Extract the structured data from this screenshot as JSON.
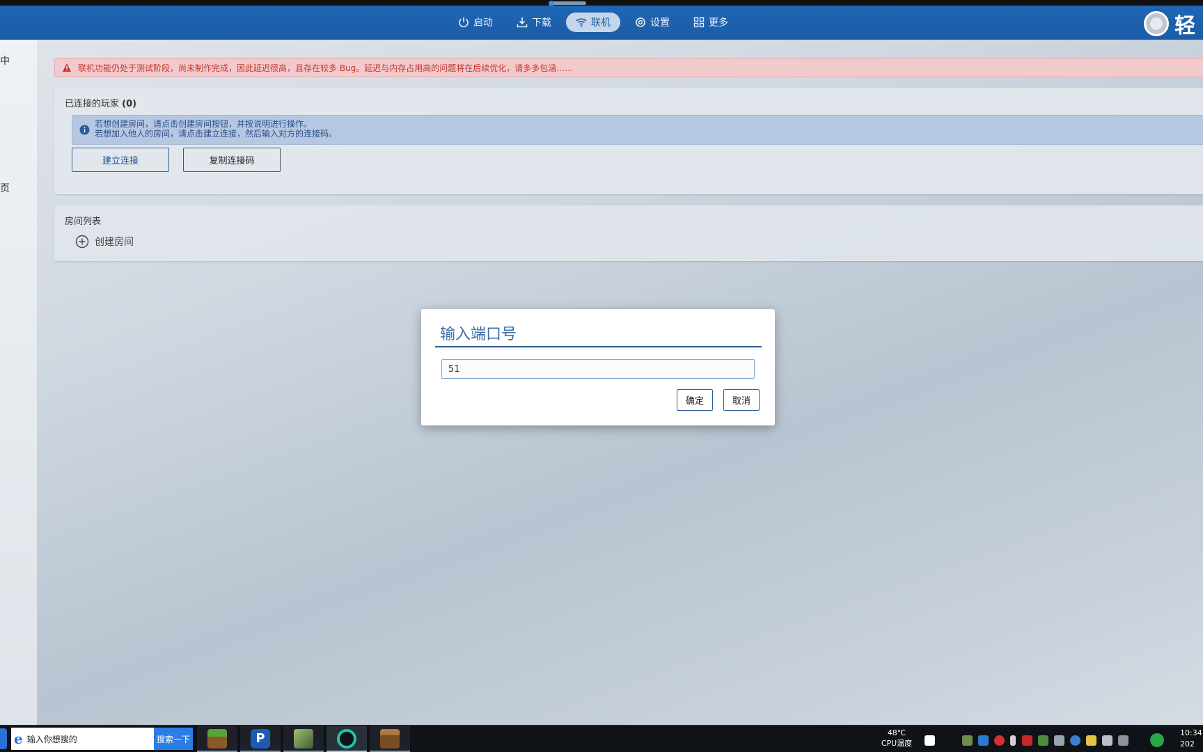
{
  "nav": {
    "items": [
      {
        "label": "启动",
        "icon": "power-icon"
      },
      {
        "label": "下载",
        "icon": "download-icon"
      },
      {
        "label": "联机",
        "icon": "wifi-icon",
        "active": true
      },
      {
        "label": "设置",
        "icon": "gear-icon"
      },
      {
        "label": "更多",
        "icon": "grid-icon"
      }
    ],
    "brand_text": "轻"
  },
  "sidebar": {
    "fragment_1": "中",
    "fragment_2": "页"
  },
  "warning": {
    "text": "联机功能仍处于测试阶段，尚未制作完成，因此延迟很高，且存在较多 Bug。延迟与内存占用高的问题将在后续优化，请多多包涵……"
  },
  "players_card": {
    "title": "已连接的玩家",
    "count": "(0)",
    "info_line_1": "若想创建房间，请点击创建房间按钮，并按说明进行操作。",
    "info_line_2": "若想加入他人的房间，请点击建立连接，然后输入对方的连接码。",
    "connect_button": "建立连接",
    "copy_code_button": "复制连接码"
  },
  "rooms_card": {
    "title": "房间列表",
    "create_room": "创建房间"
  },
  "dialog": {
    "title": "输入端口号",
    "input_value": "51",
    "ok_button": "确定",
    "cancel_button": "取消"
  },
  "taskbar": {
    "search_placeholder": "输入你想搜的",
    "search_button": "搜索一下",
    "cpu_temp": "48℃",
    "cpu_label": "CPU温度",
    "clock_time": "10:34",
    "clock_date": "202"
  },
  "colors": {
    "titlebar": "#1b5ca6",
    "accent": "#3b6fa6",
    "warning_bg": "#f2c9cd",
    "warning_text": "#c0392b",
    "info_bg": "#b6c7e1"
  }
}
